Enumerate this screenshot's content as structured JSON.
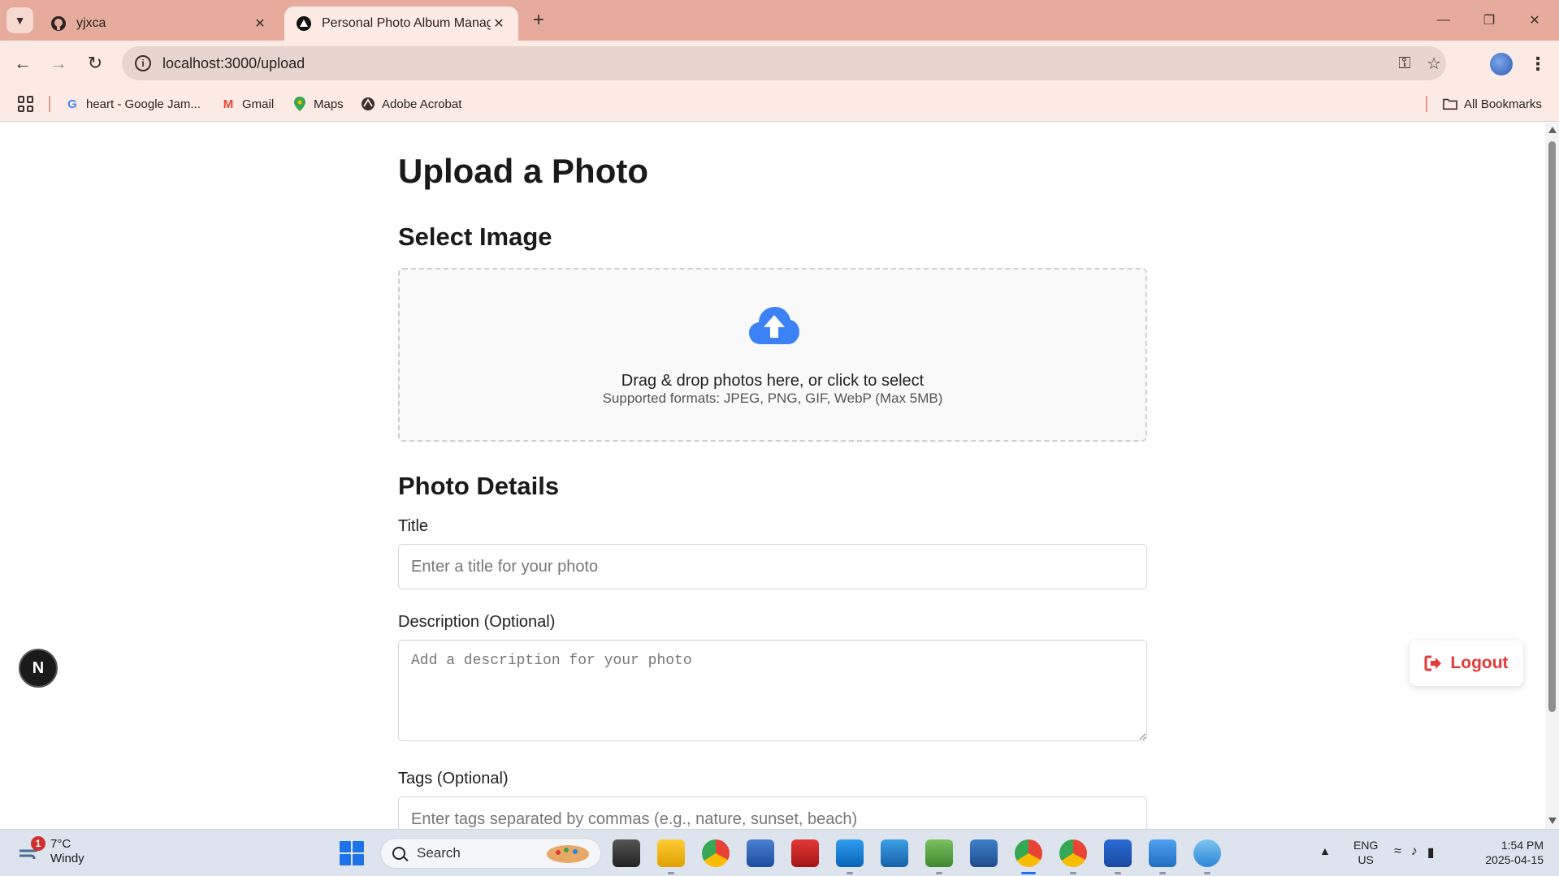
{
  "browser": {
    "tabs": [
      {
        "title": "yjxca",
        "icon": "github-icon"
      },
      {
        "title": "Personal Photo Album Manager",
        "icon": "vercel-icon"
      }
    ],
    "url": "localhost:3000/upload",
    "bookmarks": [
      {
        "label": "heart - Google Jam...",
        "icon": "google-icon"
      },
      {
        "label": "Gmail",
        "icon": "gmail-icon"
      },
      {
        "label": "Maps",
        "icon": "maps-icon"
      },
      {
        "label": "Adobe Acrobat",
        "icon": "acrobat-icon"
      }
    ],
    "all_bookmarks": "All Bookmarks"
  },
  "page": {
    "title": "Upload a Photo",
    "select_image_heading": "Select Image",
    "dropzone": {
      "main_text": "Drag & drop photos here, or click to select",
      "sub_text": "Supported formats: JPEG, PNG, GIF, WebP (Max 5MB)"
    },
    "details_heading": "Photo Details",
    "title_label": "Title",
    "title_placeholder": "Enter a title for your photo",
    "description_label": "Description (Optional)",
    "description_placeholder": "Add a description for your photo",
    "tags_label": "Tags (Optional)",
    "tags_placeholder": "Enter tags separated by commas (e.g., nature, sunset, beach)",
    "logout_label": "Logout",
    "dev_badge": "N"
  },
  "taskbar": {
    "weather_temp": "7°C",
    "weather_desc": "Windy",
    "weather_alert_count": "1",
    "search_label": "Search",
    "lang_line1": "ENG",
    "lang_line2": "US",
    "time": "1:54 PM",
    "date": "2025-04-15"
  },
  "colors": {
    "tab_strip": "#e6ab9c",
    "toolbar": "#fcebe5",
    "upload_icon": "#3b82f6",
    "logout": "#e53935"
  }
}
